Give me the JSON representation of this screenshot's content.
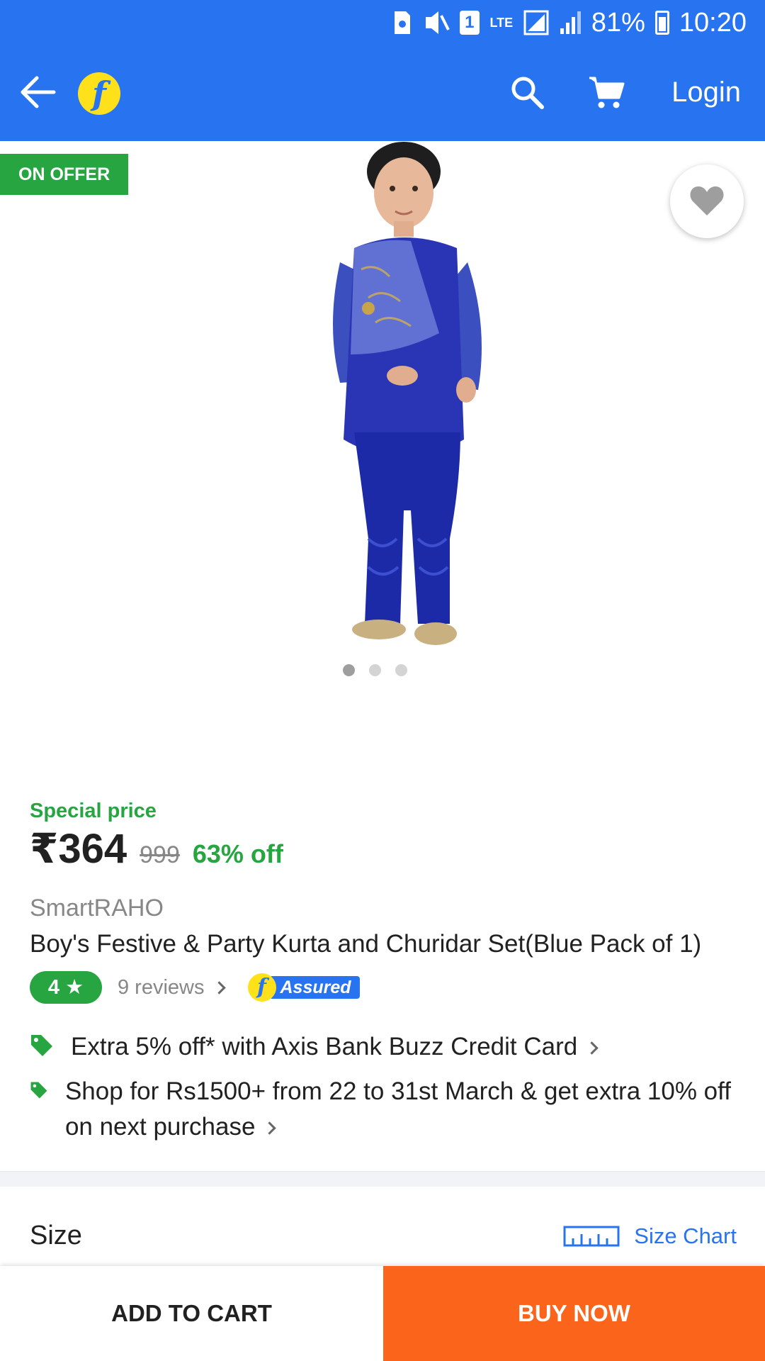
{
  "status_bar": {
    "sim": "1",
    "network": "LTE",
    "battery": "81%",
    "time": "10:20",
    "icons": [
      "sim-card-icon",
      "vibrate-icon",
      "signal-icon",
      "wifi-signal-icon",
      "battery-icon"
    ]
  },
  "header": {
    "logo_letter": "f",
    "login_label": "Login",
    "icons": [
      "back-arrow-icon",
      "search-icon",
      "cart-icon"
    ]
  },
  "product": {
    "offer_badge": "ON OFFER",
    "image_count": 3,
    "active_image": 1,
    "special_price_label": "Special price",
    "price": "₹364",
    "mrp": "999",
    "discount": "63% off",
    "brand": "SmartRAHO",
    "title": "Boy's Festive & Party Kurta and Churidar Set(Blue Pack of 1)",
    "rating": "4 ★",
    "reviews": "9 reviews",
    "assured_label": "Assured"
  },
  "offers": [
    {
      "text": "Extra 5% off* with Axis Bank Buzz Credit Card"
    },
    {
      "text": "Shop for Rs1500+ from 22 to 31st March & get extra 10% off on next purchase"
    }
  ],
  "size_section": {
    "label": "Size",
    "chart_link": "Size Chart"
  },
  "actions": {
    "add_to_cart": "ADD TO CART",
    "buy_now": "BUY NOW"
  },
  "colors": {
    "brand_blue": "#2874f0",
    "offer_green": "#26a541",
    "buy_orange": "#fb641b"
  }
}
